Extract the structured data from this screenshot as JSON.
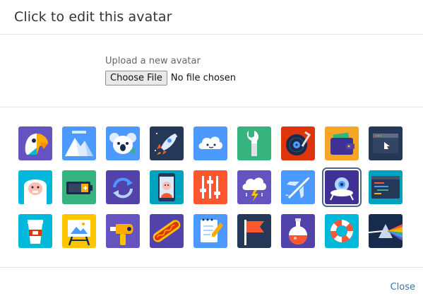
{
  "dialog": {
    "title": "Click to edit this avatar"
  },
  "upload": {
    "label": "Upload a new avatar",
    "button_label": "Choose File",
    "status": "No file chosen"
  },
  "avatars": [
    {
      "name": "parrot",
      "color": "#6554c0"
    },
    {
      "name": "mountains",
      "color": "#4c9aff"
    },
    {
      "name": "koala",
      "color": "#4c9aff"
    },
    {
      "name": "rocket",
      "color": "#253858"
    },
    {
      "name": "cloud",
      "color": "#4c9aff"
    },
    {
      "name": "wrench",
      "color": "#36b37e"
    },
    {
      "name": "vinyl-record",
      "color": "#de350b"
    },
    {
      "name": "wallet",
      "color": "#f5a623"
    },
    {
      "name": "browser-window",
      "color": "#253858"
    },
    {
      "name": "yeti",
      "color": "#00b8d9"
    },
    {
      "name": "battery",
      "color": "#36b37e"
    },
    {
      "name": "refresh",
      "color": "#5243aa"
    },
    {
      "name": "phone-selfie",
      "color": "#00a3bf"
    },
    {
      "name": "sliders",
      "color": "#ff5630"
    },
    {
      "name": "storm-cloud",
      "color": "#6554c0"
    },
    {
      "name": "airplane",
      "color": "#4c9aff"
    },
    {
      "name": "ufo",
      "color": "#403294",
      "selected": true
    },
    {
      "name": "code-editor",
      "color": "#00a3bf"
    },
    {
      "name": "coffee-cup",
      "color": "#00b8d9"
    },
    {
      "name": "easel",
      "color": "#ffc400"
    },
    {
      "name": "hairdryer",
      "color": "#6554c0"
    },
    {
      "name": "hotdog",
      "color": "#5243aa"
    },
    {
      "name": "notepad",
      "color": "#4c9aff"
    },
    {
      "name": "flag",
      "color": "#253858"
    },
    {
      "name": "potion",
      "color": "#5243aa"
    },
    {
      "name": "life-ring",
      "color": "#00b8d9"
    },
    {
      "name": "prism",
      "color": "#172b4d"
    }
  ],
  "footer": {
    "close_label": "Close"
  }
}
